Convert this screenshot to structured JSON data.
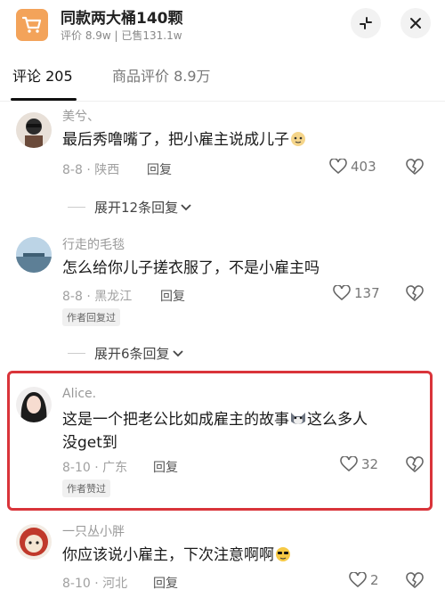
{
  "header": {
    "title": "同款两大桶140颗",
    "subtitle": "评价 8.9w | 已售131.1w"
  },
  "tabs": [
    {
      "label": "评论 205",
      "active": true
    },
    {
      "label": "商品评价 8.9万",
      "active": false
    }
  ],
  "comments": [
    {
      "username": "美兮、",
      "text": "最后秀噜嘴了，把小雇主说成儿子",
      "date": "8-8",
      "location": "陕西",
      "reply_label": "回复",
      "likes": "403",
      "emoji": "dog-face-icon",
      "expand": "展开12条回复"
    },
    {
      "username": "行走的毛毯",
      "text": "怎么给你儿子搓衣服了，不是小雇主吗",
      "date": "8-8",
      "location": "黑龙江",
      "reply_label": "回复",
      "likes": "137",
      "badge": "作者回复过",
      "expand": "展开6条回复"
    },
    {
      "username": "Alice.",
      "text_line1": "这是一个把老公比如成雇主的故事",
      "text_line1_after": "这么多人",
      "text_line2": "没get到",
      "date": "8-10",
      "location": "广东",
      "reply_label": "回复",
      "likes": "32",
      "badge": "作者赞过",
      "emoji": "husky-face-icon",
      "highlighted": true,
      "highlight_color": "#d9343a"
    },
    {
      "username": "一只丛小胖",
      "text": "你应该说小雇主，下次注意啊啊",
      "date": "8-10",
      "location": "河北",
      "reply_label": "回复",
      "likes": "2",
      "emoji": "sunglasses-face-icon"
    }
  ],
  "colors": {
    "cart_icon_bg": "#f3a35a",
    "muted_text": "#999999",
    "highlight": "#d9343a"
  }
}
